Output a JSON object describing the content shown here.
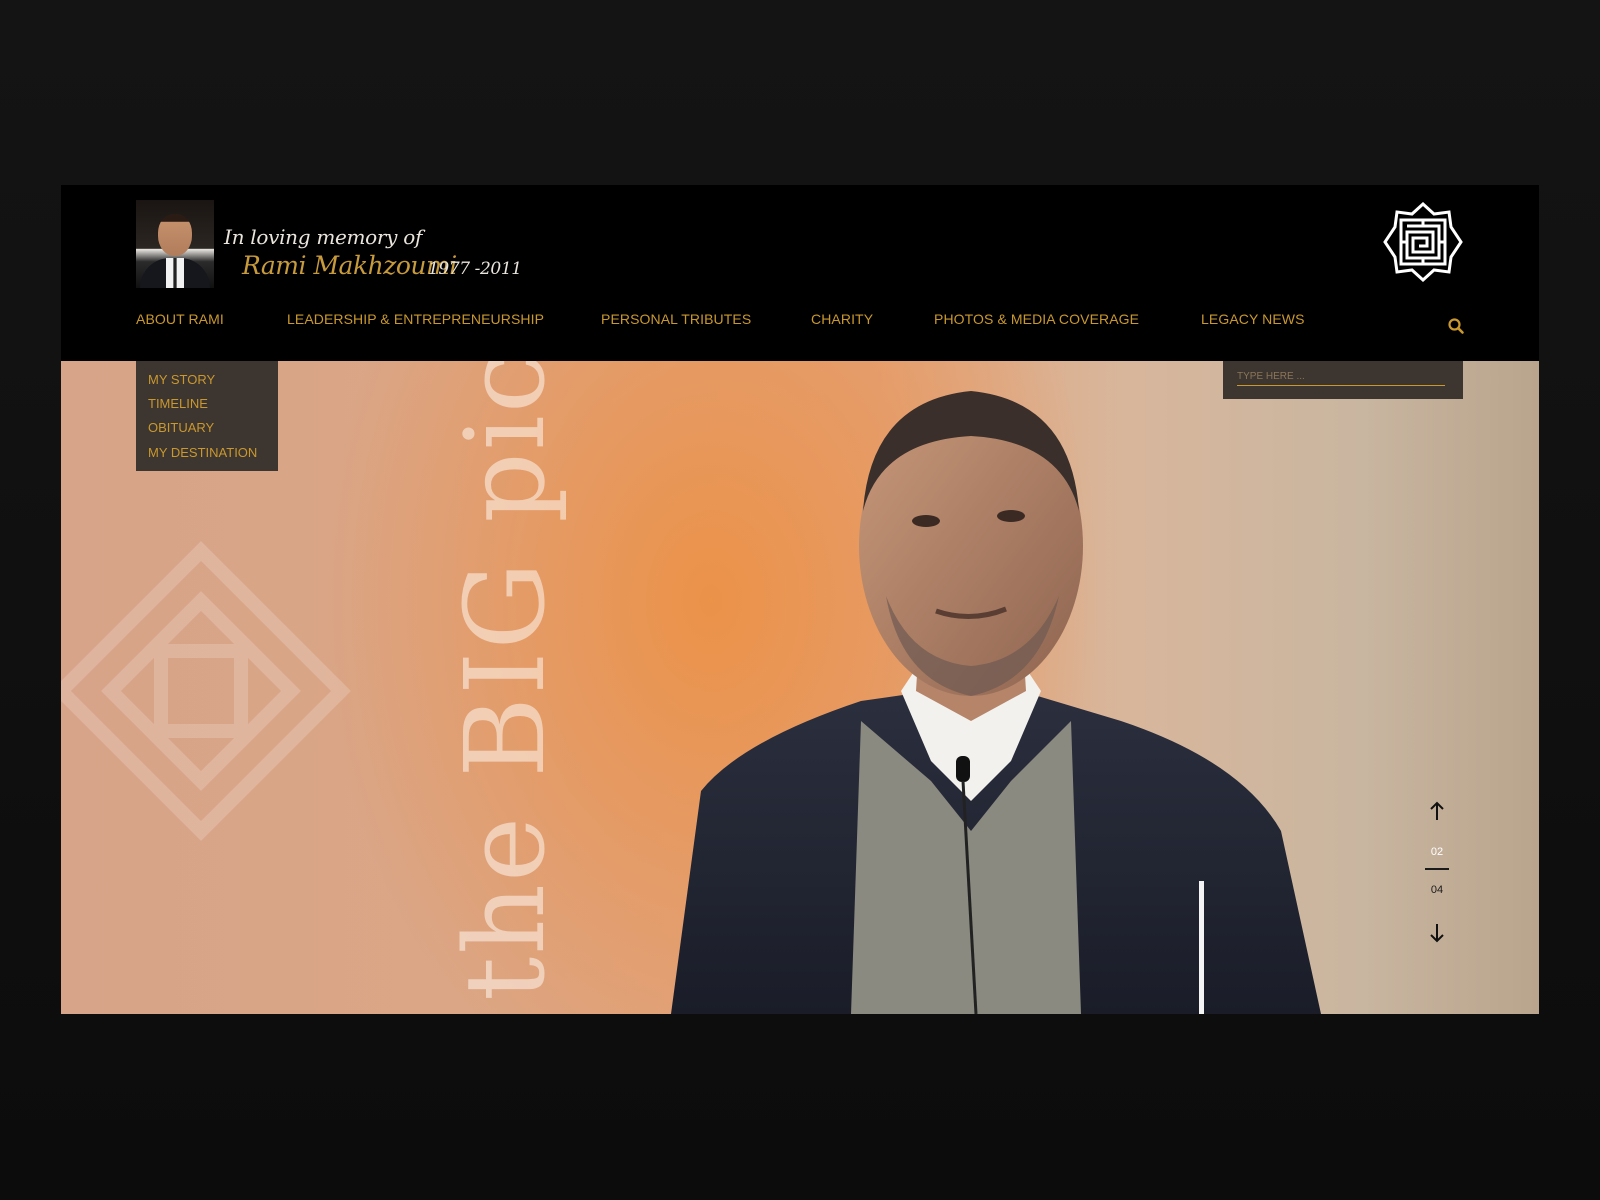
{
  "header": {
    "memory_text": "In loving memory of",
    "name": "Rami Makhzoumi",
    "years": "1977 -2011"
  },
  "nav": {
    "items": [
      {
        "label": "ABOUT RAMI"
      },
      {
        "label": "LEADERSHIP & ENTREPRENEURSHIP"
      },
      {
        "label": "PERSONAL TRIBUTES"
      },
      {
        "label": "CHARITY"
      },
      {
        "label": "PHOTOS & MEDIA COVERAGE"
      },
      {
        "label": "LEGACY NEWS"
      }
    ],
    "search_icon": "search-icon"
  },
  "dropdown": {
    "items": [
      {
        "label": "MY STORY"
      },
      {
        "label": "TIMELINE"
      },
      {
        "label": "OBITUARY"
      },
      {
        "label": "MY DESTINATION"
      }
    ]
  },
  "search": {
    "placeholder": "TYPE HERE ..."
  },
  "hero": {
    "tagline": "the BIG pictu"
  },
  "pager": {
    "current": "02",
    "total": "04"
  },
  "colors": {
    "accent": "#c9982f",
    "background": "#000000",
    "dropdown_bg": "#3d352f"
  }
}
